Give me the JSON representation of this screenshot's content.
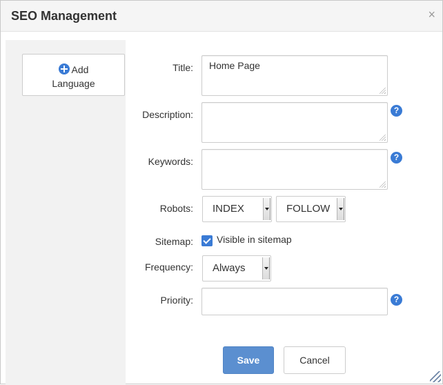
{
  "dialog": {
    "title": "SEO Management",
    "close_label": "×"
  },
  "sidebar": {
    "add_language_line1": "Add",
    "add_language_line2": "Language"
  },
  "form": {
    "title_label": "Title:",
    "title_value": "Home Page",
    "description_label": "Description:",
    "description_value": "",
    "keywords_label": "Keywords:",
    "keywords_value": "",
    "robots_label": "Robots:",
    "robots_index_value": "INDEX",
    "robots_follow_value": "FOLLOW",
    "sitemap_label": "Sitemap:",
    "sitemap_checkbox_label": "Visible in sitemap",
    "sitemap_checked": true,
    "frequency_label": "Frequency:",
    "frequency_value": "Always",
    "priority_label": "Priority:",
    "priority_value": "",
    "help_glyph": "?"
  },
  "buttons": {
    "save": "Save",
    "cancel": "Cancel"
  },
  "colors": {
    "accent": "#3a7bd5",
    "save_button": "#5b8fd0"
  }
}
